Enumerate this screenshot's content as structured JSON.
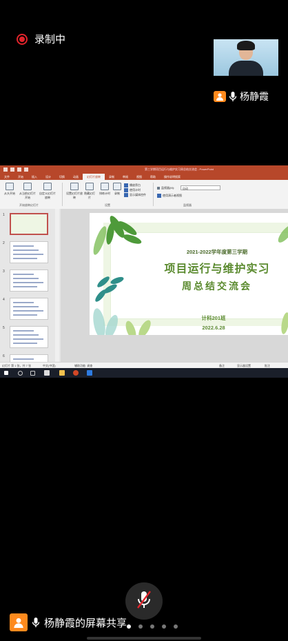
{
  "recording": {
    "label": "录制中",
    "icon": "record-icon"
  },
  "participant": {
    "name": "杨静霞",
    "avatar_icon": "person-icon",
    "mic_icon": "mic-icon"
  },
  "powerpoint": {
    "doc_title": "第三学期项目运行与维护实习周总结交流会 - PowerPoint",
    "tabs": [
      "文件",
      "开始",
      "插入",
      "设计",
      "切换",
      "动画",
      "幻灯片放映",
      "录制",
      "审阅",
      "视图",
      "帮助",
      "操作说明搜索"
    ],
    "active_tab": "幻灯片放映",
    "ribbon": {
      "from_start": "从头开始",
      "from_current": "从当前幻灯片开始",
      "custom": "自定义幻灯片放映",
      "group_start": "开始放映幻灯片",
      "setup": "设置幻灯片放映",
      "hide": "隐藏幻灯片",
      "rehearse": "排练计时",
      "record": "录制",
      "play_narration": "播放旁白",
      "use_timings": "使用计时",
      "show_media": "显示媒体控件",
      "group_setup": "设置",
      "monitor_label": "监视器(M):",
      "monitor_value": "自动",
      "presenter_view": "使用演示者视图",
      "group_monitor": "监视器"
    },
    "thumb_numbers": [
      "1",
      "2",
      "3",
      "4",
      "5",
      "6"
    ],
    "slide": {
      "term": "2021-2022学年度第三学期",
      "title": "项目运行与维护实习",
      "subtitle": "周总结交流会",
      "class": "计科201班",
      "date": "2022.6.28"
    },
    "status": {
      "slide_count": "幻灯片 第 1 张，共 7 张",
      "language": "中文(中国)",
      "accessibility": "辅助功能: 调查",
      "notes": "备注",
      "display_settings": "显示器设置",
      "comments": "批注"
    }
  },
  "bottom": {
    "share_label": "杨静霞的屏幕共享",
    "mic_off_icon": "mic-off-icon",
    "page_dots": 5,
    "active_dot": 0
  }
}
